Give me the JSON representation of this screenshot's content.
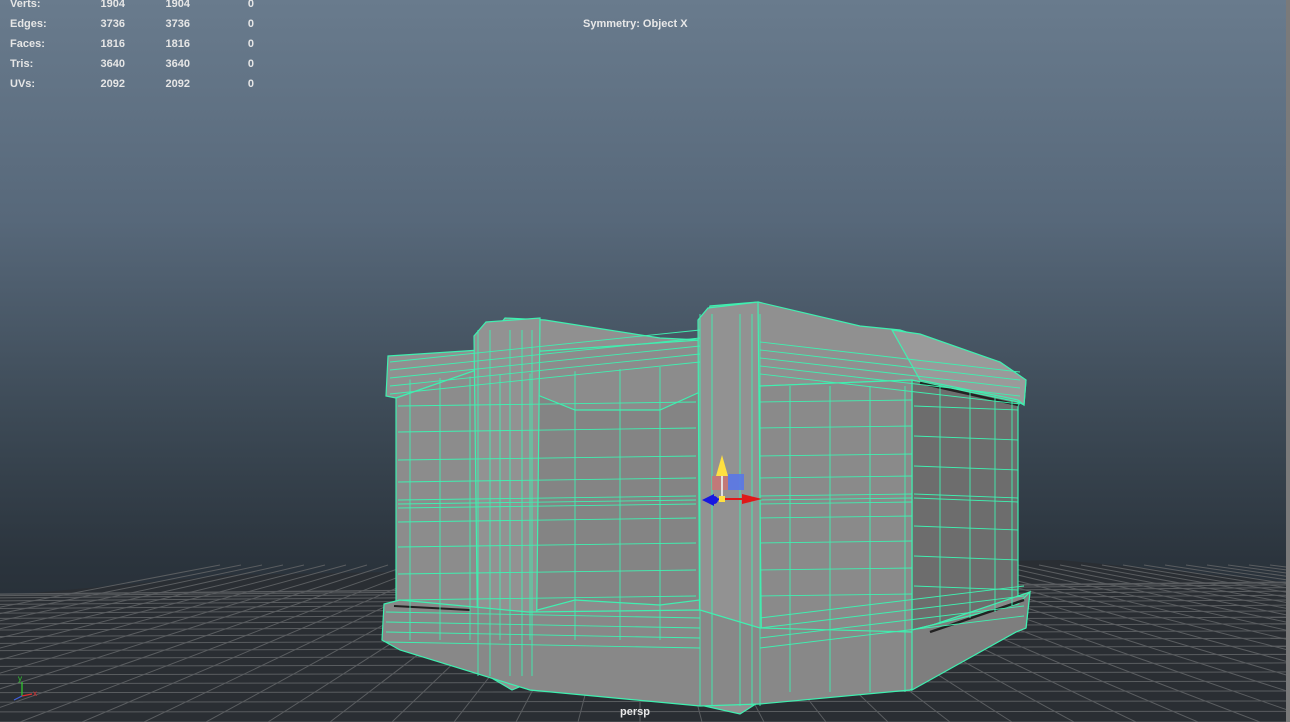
{
  "stats": [
    {
      "label": "Verts:",
      "values": [
        "1904",
        "1904",
        "0"
      ]
    },
    {
      "label": "Edges:",
      "values": [
        "3736",
        "3736",
        "0"
      ]
    },
    {
      "label": "Faces:",
      "values": [
        "1816",
        "1816",
        "0"
      ]
    },
    {
      "label": "Tris:",
      "values": [
        "3640",
        "3640",
        "0"
      ]
    },
    {
      "label": "UVs:",
      "values": [
        "2092",
        "2092",
        "0"
      ]
    }
  ],
  "symmetry_label": "Symmetry: Object X",
  "camera_name": "persp",
  "axis_indicator": {
    "x": "x",
    "y": "y"
  },
  "colors": {
    "wireframe": "#3ff0b0",
    "mesh_fill": "#8a8a8a",
    "grid": "#5a5a5a",
    "manip_x": "#e01818",
    "manip_y": "#ffe040",
    "manip_z": "#1818e0"
  },
  "icons": [
    "move-manipulator-icon",
    "axis-orientation-icon"
  ]
}
